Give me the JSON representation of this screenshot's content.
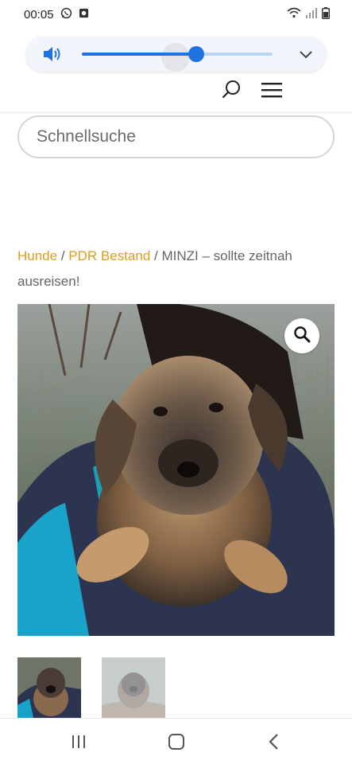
{
  "status_bar": {
    "time": "00:05",
    "left_icons": [
      "whatsapp-icon",
      "notification-app-icon"
    ],
    "right_icons": [
      "wifi-icon",
      "signal-icon",
      "battery-icon"
    ]
  },
  "volume": {
    "level": 0.6,
    "accent_color": "#1f73e0",
    "track_color": "#b9d4f4"
  },
  "header": {
    "icons": [
      "search-icon",
      "hamburger-menu-icon"
    ]
  },
  "search": {
    "placeholder": "Schnellsuche"
  },
  "breadcrumb": {
    "link1": "Hunde",
    "sep1": " / ",
    "link2": "PDR Bestand",
    "sep2": " / ",
    "current": "MINZI – sollte zeitnah ausreisen!",
    "link_color": "#e09b1b"
  },
  "gallery": {
    "zoom_icon": "magnifier-icon",
    "thumbnail_count": 2
  },
  "nav_bar": {
    "buttons": [
      "recents-icon",
      "home-icon",
      "back-icon"
    ]
  }
}
